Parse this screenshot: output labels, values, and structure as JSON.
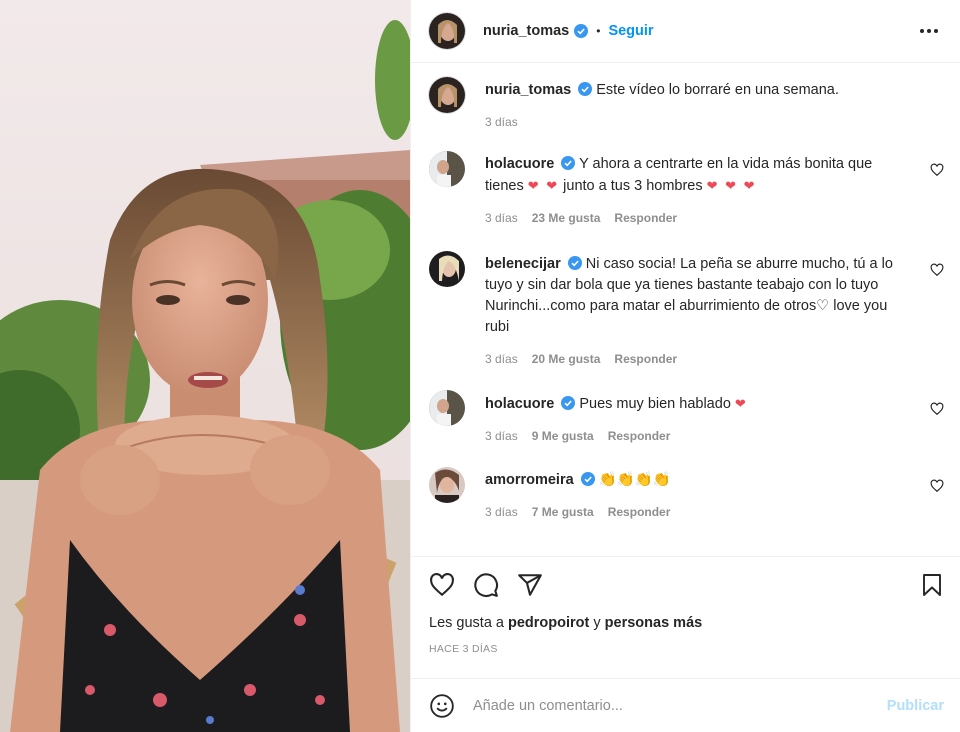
{
  "header": {
    "username": "nuria_tomas",
    "separator": "•",
    "follow_label": "Seguir"
  },
  "caption": {
    "username": "nuria_tomas",
    "text": "Este vídeo lo borraré en una semana.",
    "time": "3 días"
  },
  "comments": [
    {
      "username": "holacuore",
      "text": "Y ahora a centrarte en la vida más bonita que tienes",
      "emoji_a": "❤ ❤",
      "text2": " junto a tus 3 hombres ",
      "emoji_b": "❤ ❤ ❤",
      "time": "3 días",
      "likes": "23 Me gusta",
      "reply": "Responder"
    },
    {
      "username": "belenecijar",
      "text": "Ni caso socia! La peña se aburre mucho, tú a lo tuyo y sin dar bola que ya tienes bastante teabajo con lo tuyo Nurinchi...como para matar el aburrimiento de otros♡ love you rubi",
      "time": "3 días",
      "likes": "20 Me gusta",
      "reply": "Responder"
    },
    {
      "username": "holacuore",
      "text": "Pues muy bien hablado",
      "emoji_a": "❤",
      "time": "3 días",
      "likes": "9 Me gusta",
      "reply": "Responder"
    },
    {
      "username": "amorromeira",
      "text": "",
      "emoji_a": "👏👏👏👏",
      "time": "3 días",
      "likes": "7 Me gusta",
      "reply": "Responder"
    }
  ],
  "likes_line": {
    "prefix": "Les gusta a ",
    "user": "pedropoirot",
    "mid": " y ",
    "rest": "personas más"
  },
  "posted_ago": "HACE 3 DÍAS",
  "add_comment": {
    "placeholder": "Añade un comentario...",
    "publish_label": "Publicar"
  },
  "colors": {
    "accent": "#0095f6",
    "verified": "#3897f0",
    "heart": "#ed4956",
    "publish_disabled": "#b2dffc"
  },
  "icons": [
    "verified-icon",
    "more-icon",
    "heart-icon",
    "comment-icon",
    "share-icon",
    "bookmark-icon",
    "emoji-icon"
  ]
}
